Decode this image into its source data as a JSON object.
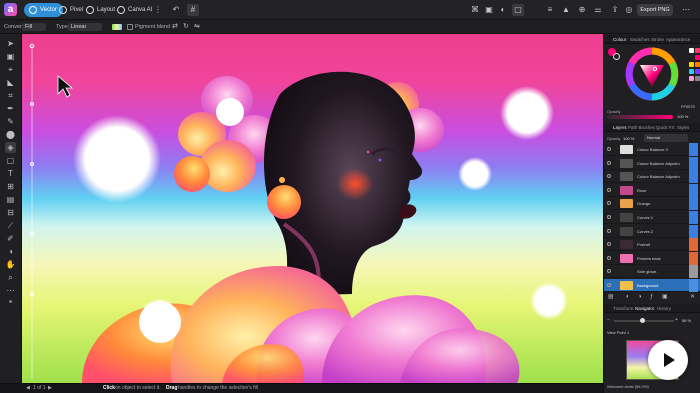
{
  "topbar": {
    "logo": "a",
    "personas": [
      "Vector",
      "Pixel",
      "Layout",
      "Canva AI"
    ],
    "export_label": "Export PNG"
  },
  "context": {
    "label_convert": "Convert",
    "convert_value": "Fill",
    "label_type": "Type",
    "type_value": "Linear",
    "pigment_label": "Pigment blend"
  },
  "panel": {
    "top_tabs": [
      "Colour",
      "Swatches",
      "Stroke",
      "Appearance"
    ],
    "hex_value": "FF0079",
    "opacity_label": "Opacity",
    "opacity_value": "100 %",
    "layer_tabs": [
      "Layers",
      "Path Brushes",
      "Quick FX",
      "Styles"
    ],
    "opacity_short": "Opacity",
    "layer_opacity": "100 %",
    "blend_mode": "Normal",
    "layers": [
      {
        "name": "Colour Balance 3",
        "thumb": "#dedede",
        "chip": "#3b7fe0",
        "selected": false
      },
      {
        "name": "Colour Balance Adjustm",
        "thumb": "#555",
        "chip": "#3b7fe0",
        "selected": false
      },
      {
        "name": "Colour Balance Adjustm",
        "thumb": "#555",
        "chip": "#3b7fe0",
        "selected": false
      },
      {
        "name": "Rose",
        "thumb": "#c24a8a",
        "chip": "#3b7fe0",
        "selected": false
      },
      {
        "name": "Orange",
        "thumb": "#e9a24a",
        "chip": "#3b7fe0",
        "selected": false
      },
      {
        "name": "Curves 1",
        "thumb": "#444",
        "chip": "#3b7fe0",
        "selected": false
      },
      {
        "name": "Curves 2",
        "thumb": "#444",
        "chip": "#3b7fe0",
        "selected": false
      },
      {
        "name": "Portrait",
        "thumb": "#3a2a35",
        "chip": "#e2683a",
        "selected": false
      },
      {
        "name": "Flowers back",
        "thumb": "#ef6fb0",
        "chip": "#e2683a",
        "selected": false
      },
      {
        "name": "Side glows",
        "thumb": "#222",
        "chip": "#9a9aa0",
        "selected": false
      },
      {
        "name": "Background",
        "thumb": "#f0c04a",
        "chip": "#4a90e2",
        "selected": true
      }
    ],
    "bottom_tabs": [
      "Transform",
      "Navigator",
      "History"
    ],
    "zoom_value": "56 %",
    "view_point": "View Point 1",
    "nav_caption": "Welcome Artist (56.0%)"
  },
  "status": {
    "page": "1 of 1",
    "hint_a": "Click",
    "hint_b": "on object to select it.",
    "hint_c": "Drag",
    "hint_d": "handles to change the selection's fill"
  },
  "colors": {
    "accent": "#2f8fd8",
    "primary_swatch": "#FF0079",
    "selected_layer": "#2b6fb8"
  },
  "icons": {
    "play": "play-icon",
    "undo": "undo-icon",
    "grid": "grid-icon"
  }
}
